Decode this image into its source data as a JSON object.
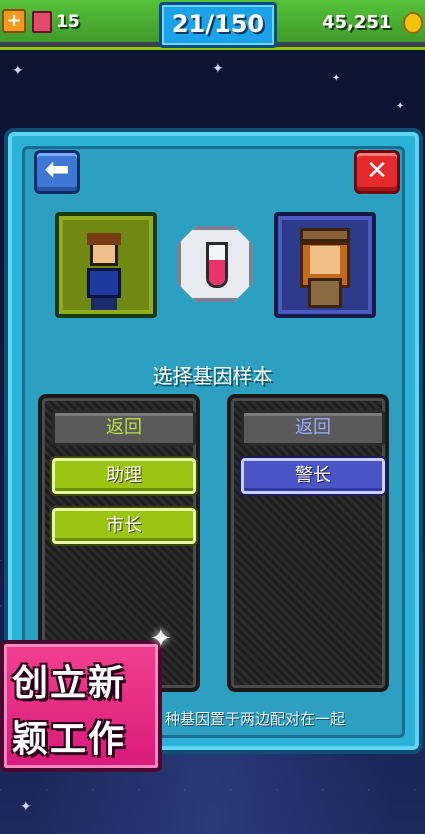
{
  "hud": {
    "health_icon": "plus-icon",
    "bux_icon": "bux-icon",
    "bux_count": "15",
    "floor_counter": "21/150",
    "coins": "45,251",
    "coin_icon": "coin-icon"
  },
  "dialog": {
    "back_icon": "arrow-left-icon",
    "close_icon": "close-icon",
    "left_portrait": "assistant-avatar",
    "right_portrait": "sheriff-avatar",
    "gene_icon": "test-tube-icon",
    "title": "选择基因样本",
    "left_list": {
      "back_label": "返回",
      "items": [
        "助理",
        "市长"
      ]
    },
    "right_list": {
      "back_label": "返回",
      "items": [
        "警长"
      ]
    },
    "hint": "种基因置于两边配对在一起"
  },
  "promo": {
    "line1": "创立新",
    "line2": "颖工作"
  },
  "colors": {
    "panel": "#2ab3d6",
    "green_button": "#9cc412",
    "purple_button": "#4a54c4",
    "promo_pink": "#f24090"
  }
}
